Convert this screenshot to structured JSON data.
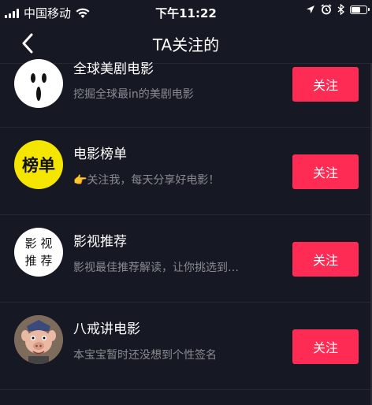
{
  "status_bar": {
    "carrier": "中国移动",
    "time": "下午11:22"
  },
  "nav": {
    "title": "TA关注的"
  },
  "accent_color": "#fe2c55",
  "following": [
    {
      "name": "全球美剧电影",
      "bio": "挖掘全球最in的美剧电影",
      "button_label": "关注",
      "avatar": "scream-mask-avatar"
    },
    {
      "name": "电影榜单",
      "bio": "👉关注我，每天分享好电影！",
      "button_label": "关注",
      "avatar": "bangdan-logo-avatar",
      "avatar_text": "榜单"
    },
    {
      "name": "影视推荐",
      "bio": "影视最佳推荐解读，让你挑选到…",
      "button_label": "关注",
      "avatar": "yingshi-tuijian-logo-avatar",
      "avatar_text_1": "影 视",
      "avatar_text_2": "推 荐"
    },
    {
      "name": "八戒讲电影",
      "bio": "本宝宝暂时还没想到个性签名",
      "button_label": "关注",
      "avatar": "pig-character-avatar"
    }
  ]
}
